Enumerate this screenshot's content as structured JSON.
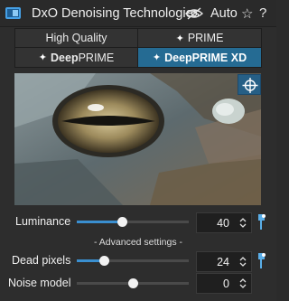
{
  "header": {
    "title": "DxO Denoising Technologies",
    "auto_label": "Auto",
    "star_icon": "☆",
    "help_icon": "?"
  },
  "modes": {
    "high_quality": "High Quality",
    "prime": "PRIME",
    "deep_prefix": "Deep",
    "deepprime_suffix": "PRIME",
    "deepprime_xd_suffix": "PRIME XD",
    "spark_icon": "✦",
    "selected": "DeepPRIME XD"
  },
  "colors": {
    "accent": "#3a8fd0",
    "selected_mode": "#256b93"
  },
  "luminance": {
    "label": "Luminance",
    "value": "40",
    "fraction": 0.4
  },
  "advanced": {
    "label": "- Advanced settings -"
  },
  "dead_pixels": {
    "label": "Dead pixels",
    "value": "24",
    "fraction": 0.24
  },
  "noise_model": {
    "label": "Noise model",
    "value": "0",
    "fraction": 0.5
  }
}
